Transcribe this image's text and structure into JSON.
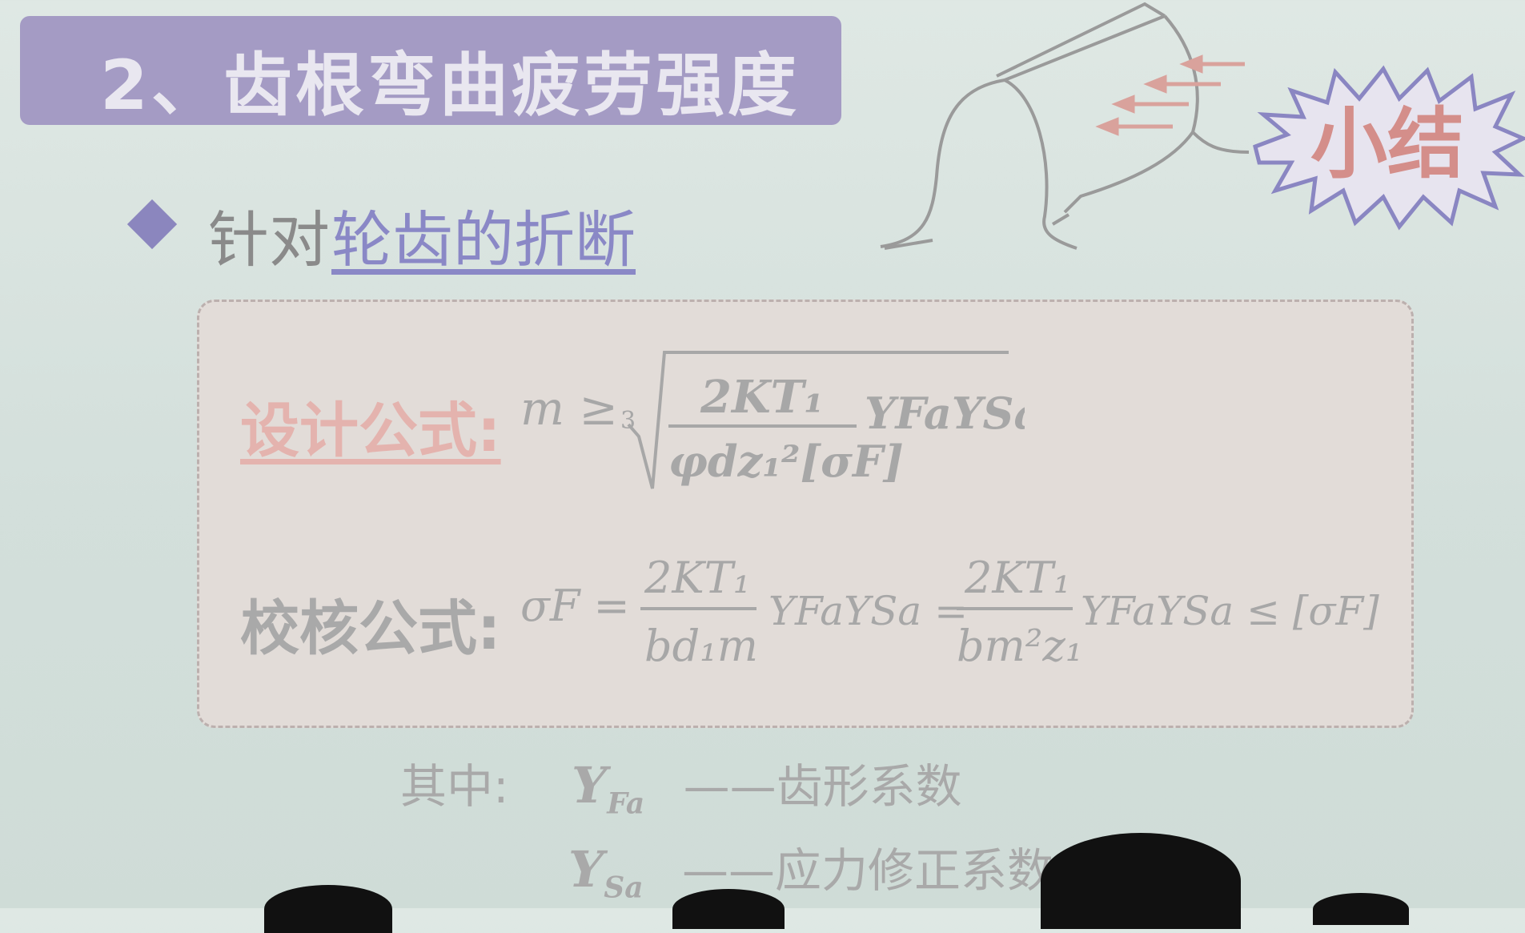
{
  "title": "2、齿根弯曲疲劳强度",
  "bullet": {
    "prefix": "针对",
    "link": "轮齿的折断"
  },
  "badge": "小结",
  "design_formula": {
    "label": "设计公式:",
    "lhs": "m ≥",
    "root_index": "3",
    "numerator": "2KT₁",
    "denominator": "φdz₁²[σF]",
    "factors": "YFaYSa"
  },
  "check_formula": {
    "label": "校核公式:",
    "lhs": "σF =",
    "frac1_num": "2KT₁",
    "frac1_den": "bd₁m",
    "mid": "YFaYSa =",
    "frac2_num": "2KT₁",
    "frac2_den": "bm²z₁",
    "tail": "YFaYSa ≤ [σF]"
  },
  "notes": {
    "prefix": "其中:",
    "items": [
      {
        "symbol": "Y",
        "sub": "Fa",
        "desc": "——齿形系数"
      },
      {
        "symbol": "Y",
        "sub": "Sa",
        "desc": "——应力修正系数"
      }
    ]
  },
  "colors": {
    "title_bar": "#a49bc4",
    "bullet_link": "#8a88c6",
    "design_label": "#e4b3ae",
    "badge_text": "#d48e8a"
  }
}
